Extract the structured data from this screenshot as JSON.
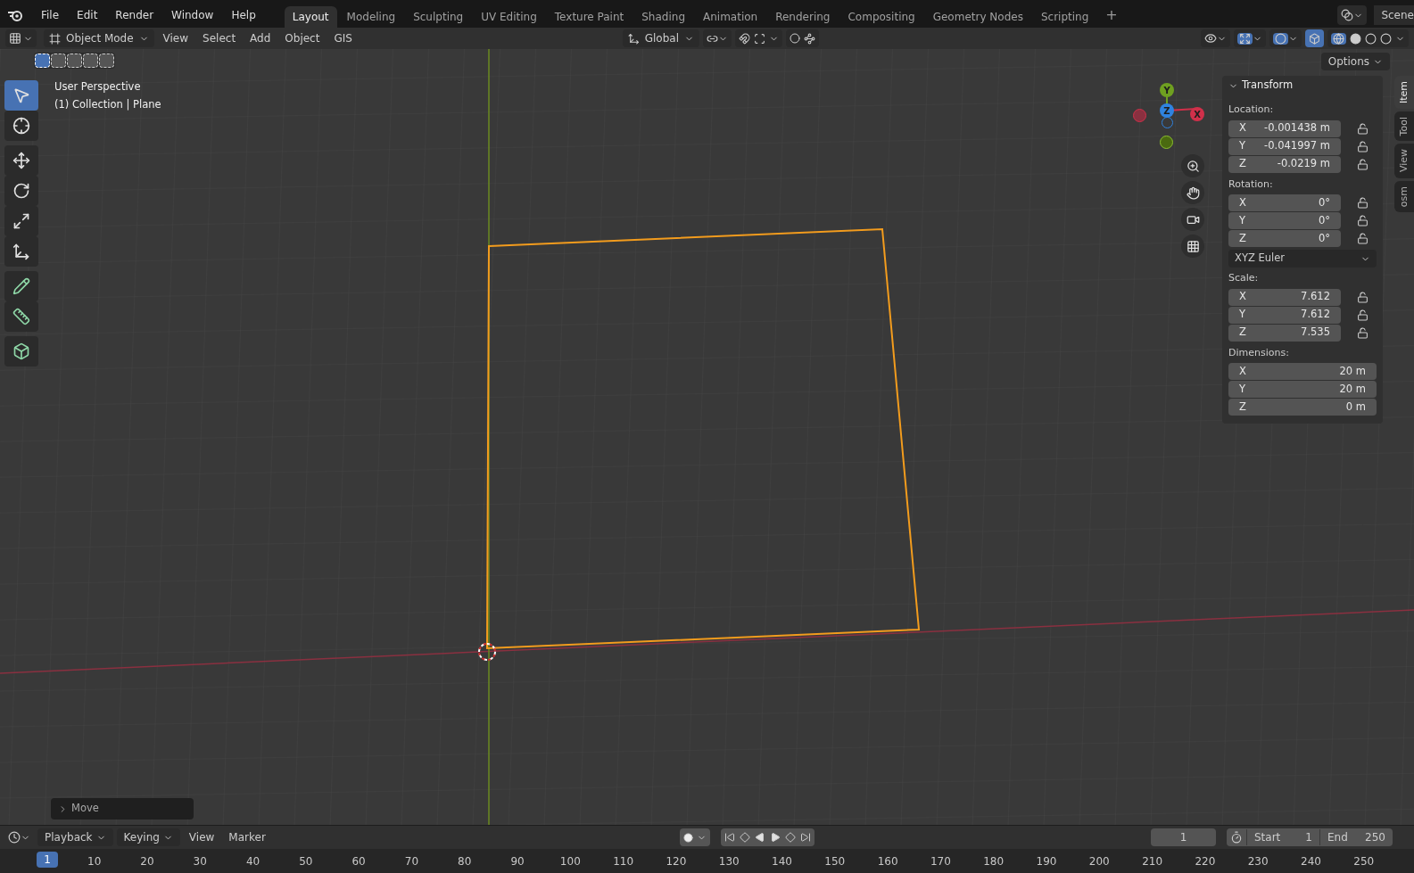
{
  "menu": [
    "File",
    "Edit",
    "Render",
    "Window",
    "Help"
  ],
  "workspaces": [
    {
      "label": "Layout",
      "selected": true
    },
    {
      "label": "Modeling",
      "selected": false
    },
    {
      "label": "Sculpting",
      "selected": false
    },
    {
      "label": "UV Editing",
      "selected": false
    },
    {
      "label": "Texture Paint",
      "selected": false
    },
    {
      "label": "Shading",
      "selected": false
    },
    {
      "label": "Animation",
      "selected": false
    },
    {
      "label": "Rendering",
      "selected": false
    },
    {
      "label": "Compositing",
      "selected": false
    },
    {
      "label": "Geometry Nodes",
      "selected": false
    },
    {
      "label": "Scripting",
      "selected": false
    }
  ],
  "add_workspace": "+",
  "scene": "Scene",
  "header": {
    "mode": "Object Mode",
    "menus": [
      "View",
      "Select",
      "Add",
      "Object",
      "GIS"
    ],
    "orientation": "Global",
    "options": "Options"
  },
  "select_modes": [
    {
      "selected": true
    },
    {
      "selected": false
    },
    {
      "selected": false
    },
    {
      "selected": false
    },
    {
      "selected": false
    }
  ],
  "viewport_info": [
    "User Perspective",
    "(1) Collection | Plane"
  ],
  "tools": [
    {
      "kind": "select",
      "selected": true
    },
    {
      "kind": "cursor",
      "selected": false
    },
    {
      "kind": "move",
      "selected": false
    },
    {
      "kind": "rotate",
      "selected": false
    },
    {
      "kind": "scale",
      "selected": false
    },
    {
      "kind": "transform",
      "selected": false
    },
    {
      "kind": "annotate",
      "selected": false
    },
    {
      "kind": "measure",
      "selected": false
    },
    {
      "kind": "add-cube",
      "selected": false
    }
  ],
  "gizmo": {
    "y": "Y",
    "z": "Z",
    "x": "X"
  },
  "sidebar": {
    "title": "Transform",
    "sections": [
      {
        "label": "Location:",
        "fields": [
          {
            "axis": "X",
            "value": "-0.001438 m",
            "locked": false
          },
          {
            "axis": "Y",
            "value": "-0.041997 m",
            "locked": false
          },
          {
            "axis": "Z",
            "value": "-0.0219 m",
            "locked": false
          }
        ]
      },
      {
        "label": "Rotation:",
        "fields": [
          {
            "axis": "X",
            "value": "0°",
            "locked": false
          },
          {
            "axis": "Y",
            "value": "0°",
            "locked": false
          },
          {
            "axis": "Z",
            "value": "0°",
            "locked": false
          }
        ],
        "mode": "XYZ Euler"
      },
      {
        "label": "Scale:",
        "fields": [
          {
            "axis": "X",
            "value": "7.612",
            "locked": false
          },
          {
            "axis": "Y",
            "value": "7.612",
            "locked": false
          },
          {
            "axis": "Z",
            "value": "7.535",
            "locked": false
          }
        ]
      },
      {
        "label": "Dimensions:",
        "fields": [
          {
            "axis": "X",
            "value": "20 m"
          },
          {
            "axis": "Y",
            "value": "20 m"
          },
          {
            "axis": "Z",
            "value": "0 m"
          }
        ]
      }
    ],
    "tabs": [
      {
        "label": "Item",
        "selected": true
      },
      {
        "label": "Tool",
        "selected": false
      },
      {
        "label": "View",
        "selected": false
      },
      {
        "label": "osm",
        "selected": false
      }
    ]
  },
  "last_operator": "Move",
  "timeline": {
    "menus": [
      "Playback",
      "Keying",
      "View",
      "Marker"
    ],
    "current_frame": "1",
    "start_label": "Start",
    "start": "1",
    "end_label": "End",
    "end": "250",
    "playhead": "1",
    "ticks": [
      "10",
      "20",
      "30",
      "40",
      "50",
      "60",
      "70",
      "80",
      "90",
      "100",
      "110",
      "120",
      "130",
      "140",
      "150",
      "160",
      "170",
      "180",
      "190",
      "200",
      "210",
      "220",
      "230",
      "240",
      "250"
    ]
  }
}
